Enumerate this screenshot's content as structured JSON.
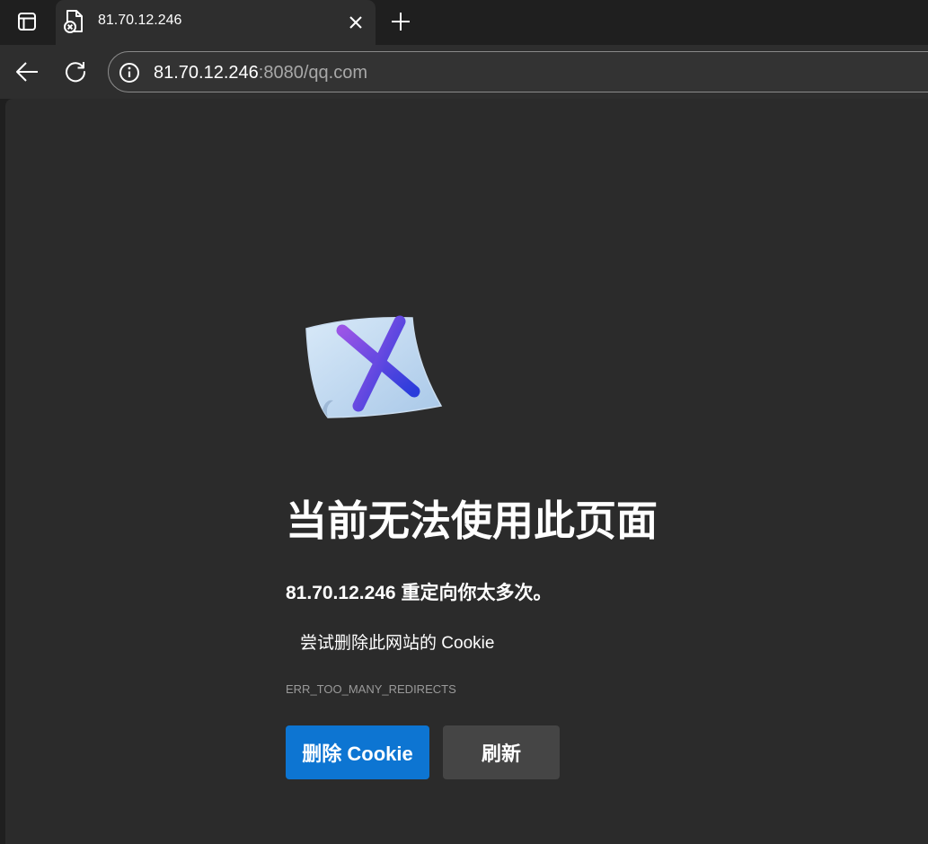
{
  "tab": {
    "title": "81.70.12.246",
    "favicon_icon": "page-error-icon"
  },
  "address_bar": {
    "host": "81.70.12.246",
    "rest": ":8080/qq.com",
    "info_icon": "info-icon"
  },
  "error_page": {
    "illustration_icon": "error-document-x-icon",
    "heading": "当前无法使用此页面",
    "subheading": "81.70.12.246 重定向你太多次。",
    "suggestion": "尝试删除此网站的 Cookie",
    "error_code": "ERR_TOO_MANY_REDIRECTS",
    "delete_cookie_label": "删除 Cookie",
    "refresh_label": "刷新"
  },
  "colors": {
    "tabstrip_bg": "#1f1f1f",
    "toolbar_bg": "#2e2e2e",
    "page_bg": "#2b2b2b",
    "primary_button": "#0d75d2",
    "secondary_button": "#454545"
  }
}
